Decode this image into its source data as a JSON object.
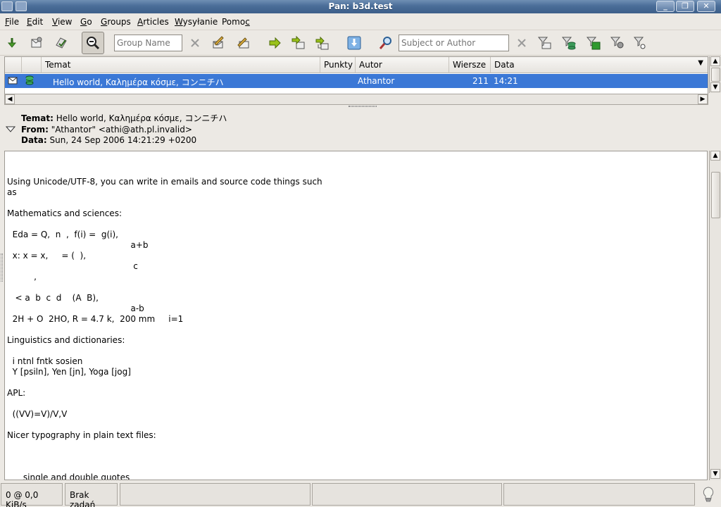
{
  "window": {
    "title": "Pan: b3d.test"
  },
  "menu": [
    {
      "label": "File",
      "u": "F",
      "rest": "ile"
    },
    {
      "label": "Edit",
      "u": "E",
      "rest": "dit"
    },
    {
      "label": "View",
      "u": "V",
      "rest": "iew"
    },
    {
      "label": "Go",
      "u": "G",
      "rest": "o"
    },
    {
      "label": "Groups",
      "u": "G",
      "rest": "roups"
    },
    {
      "label": "Articles",
      "u": "A",
      "rest": "rticles"
    },
    {
      "label": "Wysyłanie",
      "u": "W",
      "rest": "ysyłanie"
    },
    {
      "label": "Pomoc",
      "pre": "Pomo",
      "u": "c"
    }
  ],
  "toolbar": {
    "group_name_placeholder": "Group Name",
    "subject_author_placeholder": "Subject or Author"
  },
  "header_list": {
    "columns": [
      "Temat",
      "Punkty",
      "Autor",
      "Wiersze",
      "Data"
    ],
    "rows": [
      {
        "subject": "Hello world, Καλημέρα κόσμε, コンニチハ",
        "score": "",
        "author": "Athantor",
        "lines": "211",
        "date": "14:21"
      }
    ]
  },
  "article_header": {
    "subject_label": "Temat:",
    "subject": "Hello world, Καλημέρα κόσμε, コンニチハ",
    "from_label": "From:",
    "from": "\"Athantor\" <athi@ath.pl.invalid>",
    "date_label": "Data:",
    "date": "Sun, 24 Sep 2006 14:21:29 +0200"
  },
  "article_body": "Using Unicode/UTF-8, you can write in emails and source code things such\nas\n\nMathematics and sciences:\n\n  Eda = Q,  n  ,  f(i) =  g(i),\n                                              a+b\n  x: x = x,     = (  ),\n                                               c\n          ,\n\n   < a  b  c  d    (A  B),\n                                              a-b\n  2H + O  2HO, R = 4.7 k,  200 mm     i=1\n\nLinguistics and dictionaries:\n\n  i ntnl fntk sosien\n  Y [psiln], Yen [jn], Yoga [jog]\n\nAPL:\n\n  ((VV)=V)/V,V\n\nNicer typography in plain text files:\n\n\n\n      single and double quotes",
  "status": {
    "transfer": "0 @ 0,0 KiB/s",
    "tasks": "Brak zadań"
  }
}
